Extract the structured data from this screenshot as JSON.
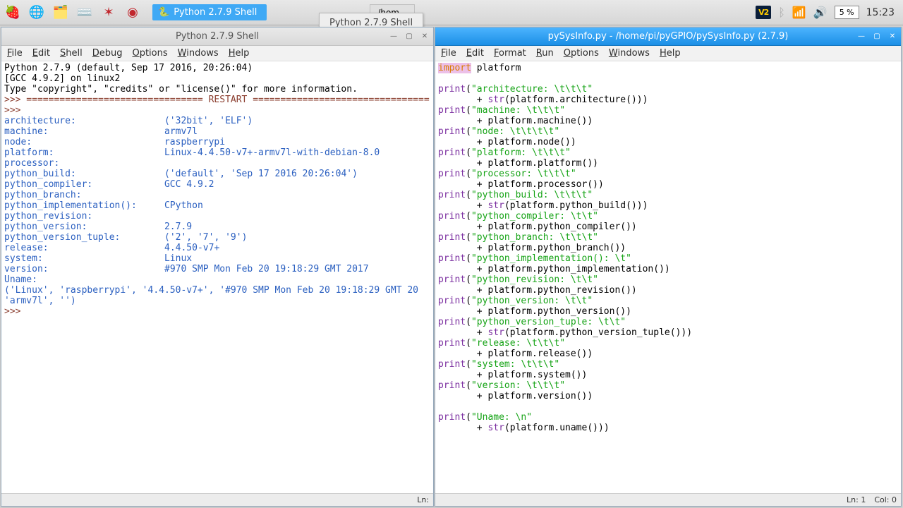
{
  "taskbar": {
    "app_button": "Python 2.7.9 Shell",
    "tooltip": "Python 2.7.9 Shell",
    "tab2": "/hom...",
    "battery": "5 %",
    "clock": "15:23"
  },
  "shell_window": {
    "title": "Python 2.7.9 Shell",
    "menus": [
      "File",
      "Edit",
      "Shell",
      "Debug",
      "Options",
      "Windows",
      "Help"
    ],
    "status": "Ln:"
  },
  "editor_window": {
    "title": "pySysInfo.py - /home/pi/pyGPIO/pySysInfo.py (2.7.9)",
    "menus": [
      "File",
      "Edit",
      "Format",
      "Run",
      "Options",
      "Windows",
      "Help"
    ],
    "status_ln": "Ln: 1",
    "status_col": "Col: 0"
  },
  "shell_output": {
    "header1": "Python 2.7.9 (default, Sep 17 2016, 20:26:04)",
    "header2": "[GCC 4.9.2] on linux2",
    "header3": "Type \"copyright\", \"credits\" or \"license()\" for more information.",
    "restart": ">>> ================================ RESTART ================================",
    "prompt": ">>> ",
    "lines": [
      {
        "k": "architecture:",
        "pad": "                ",
        "v": "('32bit', 'ELF')"
      },
      {
        "k": "machine:",
        "pad": "                     ",
        "v": "armv7l"
      },
      {
        "k": "node:",
        "pad": "                        ",
        "v": "raspberrypi"
      },
      {
        "k": "platform:",
        "pad": "                    ",
        "v": "Linux-4.4.50-v7+-armv7l-with-debian-8.0"
      },
      {
        "k": "processor:",
        "pad": "                   ",
        "v": ""
      },
      {
        "k": "python_build:",
        "pad": "                ",
        "v": "('default', 'Sep 17 2016 20:26:04')"
      },
      {
        "k": "python_compiler:",
        "pad": "             ",
        "v": "GCC 4.9.2"
      },
      {
        "k": "python_branch:",
        "pad": "               ",
        "v": ""
      },
      {
        "k": "python_implementation():",
        "pad": "     ",
        "v": "CPython"
      },
      {
        "k": "python_revision:",
        "pad": "             ",
        "v": ""
      },
      {
        "k": "python_version:",
        "pad": "              ",
        "v": "2.7.9"
      },
      {
        "k": "python_version_tuple:",
        "pad": "        ",
        "v": "('2', '7', '9')"
      },
      {
        "k": "release:",
        "pad": "                     ",
        "v": "4.4.50-v7+"
      },
      {
        "k": "system:",
        "pad": "                      ",
        "v": "Linux"
      },
      {
        "k": "version:",
        "pad": "                     ",
        "v": "#970 SMP Mon Feb 20 19:18:29 GMT 2017"
      }
    ],
    "uname_label": "Uname:",
    "uname_val1": "('Linux', 'raspberrypi', '4.4.50-v7+', '#970 SMP Mon Feb 20 19:18:29 GMT 20",
    "uname_val2": "'armv7l', '')"
  },
  "source": {
    "import_kw": "import",
    "import_mod": " platform",
    "prints": [
      {
        "label": "\"architecture: \\t\\t\\t\"",
        "cont": "str",
        "call": "(platform.architecture()))"
      },
      {
        "label": "\"machine: \\t\\t\\t\"",
        "cont": "plain",
        "call": "platform.machine())"
      },
      {
        "label": "\"node: \\t\\t\\t\\t\"",
        "cont": "plain",
        "call": "platform.node())"
      },
      {
        "label": "\"platform: \\t\\t\\t\"",
        "cont": "plain",
        "call": "platform.platform())"
      },
      {
        "label": "\"processor: \\t\\t\\t\"",
        "cont": "plain",
        "call": "platform.processor())"
      },
      {
        "label": "\"python_build: \\t\\t\\t\"",
        "cont": "str",
        "call": "(platform.python_build()))"
      },
      {
        "label": "\"python_compiler: \\t\\t\"",
        "cont": "plain",
        "call": "platform.python_compiler())"
      },
      {
        "label": "\"python_branch: \\t\\t\\t\"",
        "cont": "plain",
        "call": "platform.python_branch())"
      },
      {
        "label": "\"python_implementation(): \\t\"",
        "cont": "plain",
        "call": "platform.python_implementation())"
      },
      {
        "label": "\"python_revision: \\t\\t\"",
        "cont": "plain",
        "call": "platform.python_revision())"
      },
      {
        "label": "\"python_version: \\t\\t\"",
        "cont": "plain",
        "call": "platform.python_version())"
      },
      {
        "label": "\"python_version_tuple: \\t\\t\"",
        "cont": "str",
        "call": "(platform.python_version_tuple()))"
      },
      {
        "label": "\"release: \\t\\t\\t\"",
        "cont": "plain",
        "call": "platform.release())"
      },
      {
        "label": "\"system: \\t\\t\\t\"",
        "cont": "plain",
        "call": "platform.system())"
      },
      {
        "label": "\"version: \\t\\t\\t\"",
        "cont": "plain",
        "call": "platform.version())"
      }
    ],
    "uname_label": "\"Uname: \\n\"",
    "uname_call": "(platform.uname()))"
  }
}
